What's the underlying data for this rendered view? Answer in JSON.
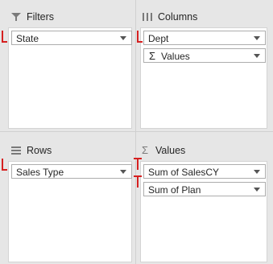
{
  "accent_color": "#d62020",
  "filters": {
    "title": "Filters",
    "icon": "filter-icon",
    "fields": [
      {
        "label": "State",
        "icon": "chevron-down-icon"
      }
    ]
  },
  "columns": {
    "title": "Columns",
    "icon": "columns-icon",
    "fields": [
      {
        "label": "Dept",
        "icon": "chevron-down-icon"
      },
      {
        "label": "Values",
        "icon": "sigma-icon"
      }
    ]
  },
  "rows": {
    "title": "Rows",
    "icon": "rows-icon",
    "fields": [
      {
        "label": "Sales Type",
        "icon": "chevron-down-icon"
      }
    ]
  },
  "values": {
    "title": "Values",
    "icon": "sigma-icon",
    "fields": [
      {
        "label": "Sum of SalesCY",
        "icon": "chevron-down-icon"
      },
      {
        "label": "Sum of Plan",
        "icon": "chevron-down-icon"
      }
    ]
  },
  "sigma_glyph": "Σ"
}
